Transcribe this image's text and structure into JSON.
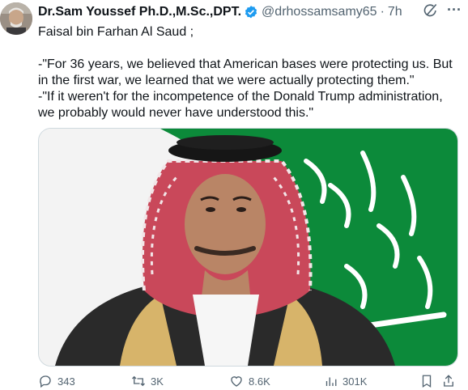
{
  "author": {
    "name": "Dr.Sam Youssef Ph.D.,M.Sc.,DPT.",
    "handle": "@drhossamsamy65",
    "separator": "·",
    "time": "7h"
  },
  "tweet": {
    "line1": "Faisal bin Farhan Al Saud ;",
    "line2": "-\"For 36 years, we believed that American bases were protecting us. But in the first war, we learned that we were actually protecting them.\"",
    "line3": "-\"If it weren't for the incompetence of the Donald Trump administration, we probably would never have understood this.\""
  },
  "actions": {
    "replies": "343",
    "reposts": "3K",
    "likes": "8.6K",
    "views": "301K"
  },
  "colors": {
    "text": "#0f1419",
    "secondary": "#536471",
    "verified": "#1d9bf0",
    "flag_green": "#0c8a3a"
  },
  "icons": [
    "verified-badge-icon",
    "grok-icon",
    "more-icon",
    "reply-icon",
    "repost-icon",
    "like-icon",
    "views-icon",
    "bookmark-icon",
    "share-icon"
  ]
}
